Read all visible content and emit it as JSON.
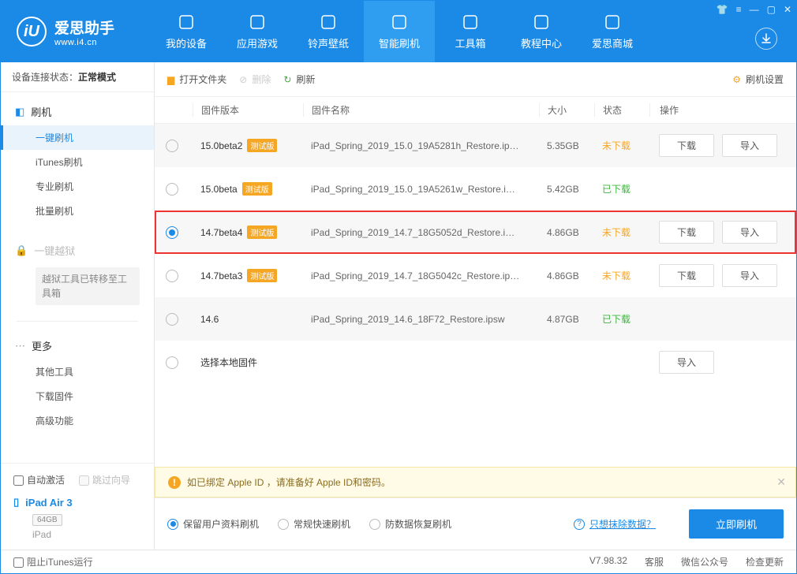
{
  "app": {
    "name": "爱思助手",
    "domain": "www.i4.cn"
  },
  "nav": [
    {
      "label": "我的设备"
    },
    {
      "label": "应用游戏"
    },
    {
      "label": "铃声壁纸"
    },
    {
      "label": "智能刷机"
    },
    {
      "label": "工具箱"
    },
    {
      "label": "教程中心"
    },
    {
      "label": "爱思商城"
    }
  ],
  "sidebar": {
    "status_label": "设备连接状态：",
    "status_value": "正常模式",
    "flash_title": "刷机",
    "flash_items": [
      "一键刷机",
      "iTunes刷机",
      "专业刷机",
      "批量刷机"
    ],
    "jailbreak_title": "一键越狱",
    "jailbreak_note": "越狱工具已转移至工具箱",
    "more_title": "更多",
    "more_items": [
      "其他工具",
      "下载固件",
      "高级功能"
    ],
    "auto_activate": "自动激活",
    "skip_guide": "跳过向导",
    "device_name": "iPad Air 3",
    "device_storage": "64GB",
    "device_type": "iPad",
    "block_itunes": "阻止iTunes运行"
  },
  "toolbar": {
    "open_folder": "打开文件夹",
    "delete": "删除",
    "refresh": "刷新",
    "settings": "刷机设置"
  },
  "columns": {
    "version": "固件版本",
    "name": "固件名称",
    "size": "大小",
    "status": "状态",
    "ops": "操作"
  },
  "beta_tag": "测试版",
  "row_actions": {
    "download": "下载",
    "import": "导入"
  },
  "rows": [
    {
      "version": "15.0beta2",
      "beta": true,
      "name": "iPad_Spring_2019_15.0_19A5281h_Restore.ip…",
      "size": "5.35GB",
      "status": "未下载",
      "status_cls": "st-orange",
      "selected": false,
      "show_dl": true,
      "show_imp": true,
      "highlight": false
    },
    {
      "version": "15.0beta",
      "beta": true,
      "name": "iPad_Spring_2019_15.0_19A5261w_Restore.i…",
      "size": "5.42GB",
      "status": "已下载",
      "status_cls": "st-green",
      "selected": false,
      "show_dl": false,
      "show_imp": false,
      "highlight": false
    },
    {
      "version": "14.7beta4",
      "beta": true,
      "name": "iPad_Spring_2019_14.7_18G5052d_Restore.i…",
      "size": "4.86GB",
      "status": "未下载",
      "status_cls": "st-orange",
      "selected": true,
      "show_dl": true,
      "show_imp": true,
      "highlight": true
    },
    {
      "version": "14.7beta3",
      "beta": true,
      "name": "iPad_Spring_2019_14.7_18G5042c_Restore.ip…",
      "size": "4.86GB",
      "status": "未下载",
      "status_cls": "st-orange",
      "selected": false,
      "show_dl": true,
      "show_imp": true,
      "highlight": false
    },
    {
      "version": "14.6",
      "beta": false,
      "name": "iPad_Spring_2019_14.6_18F72_Restore.ipsw",
      "size": "4.87GB",
      "status": "已下载",
      "status_cls": "st-green",
      "selected": false,
      "show_dl": false,
      "show_imp": false,
      "highlight": false
    },
    {
      "version": "选择本地固件",
      "beta": false,
      "name": "",
      "size": "",
      "status": "",
      "status_cls": "",
      "selected": false,
      "show_dl": false,
      "show_imp": true,
      "highlight": false
    }
  ],
  "notice": "如已绑定 Apple ID ，请准备好 Apple ID和密码。",
  "flash_opts": [
    "保留用户资料刷机",
    "常规快速刷机",
    "防数据恢复刷机"
  ],
  "erase_link": "只想抹除数据？",
  "flash_btn": "立即刷机",
  "footer": {
    "version": "V7.98.32",
    "links": [
      "客服",
      "微信公众号",
      "检查更新"
    ]
  }
}
